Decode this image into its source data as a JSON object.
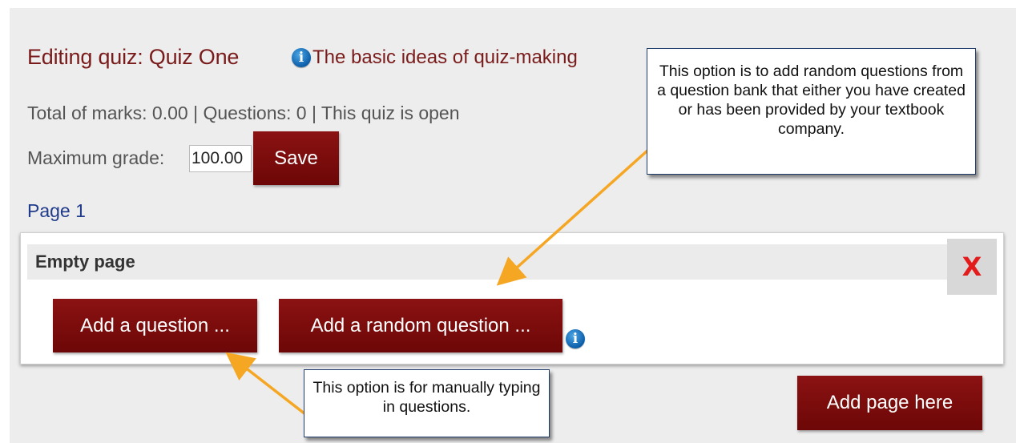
{
  "header": {
    "title": "Editing quiz: Quiz One",
    "help_link": "The basic ideas of quiz-making",
    "info_icon": "i"
  },
  "summary": "Total of marks: 0.00 | Questions: 0 | This quiz is open",
  "grade": {
    "label": "Maximum grade:",
    "value": "100.00",
    "save_label": "Save"
  },
  "page": {
    "label": "Page 1",
    "header": "Empty page",
    "delete_glyph": "X",
    "add_question_label": "Add a question ...",
    "add_random_label": "Add a random question ...",
    "add_page_label": "Add page here"
  },
  "callouts": {
    "random": "This option is to add random questions from a question bank that either you have created or has been provided by your textbook company.",
    "manual": "This option is for manually typing in questions."
  },
  "colors": {
    "button": "#7a0c0c",
    "title": "#7a1b1b",
    "link": "#1f3b8a",
    "arrow": "#f5a623"
  }
}
